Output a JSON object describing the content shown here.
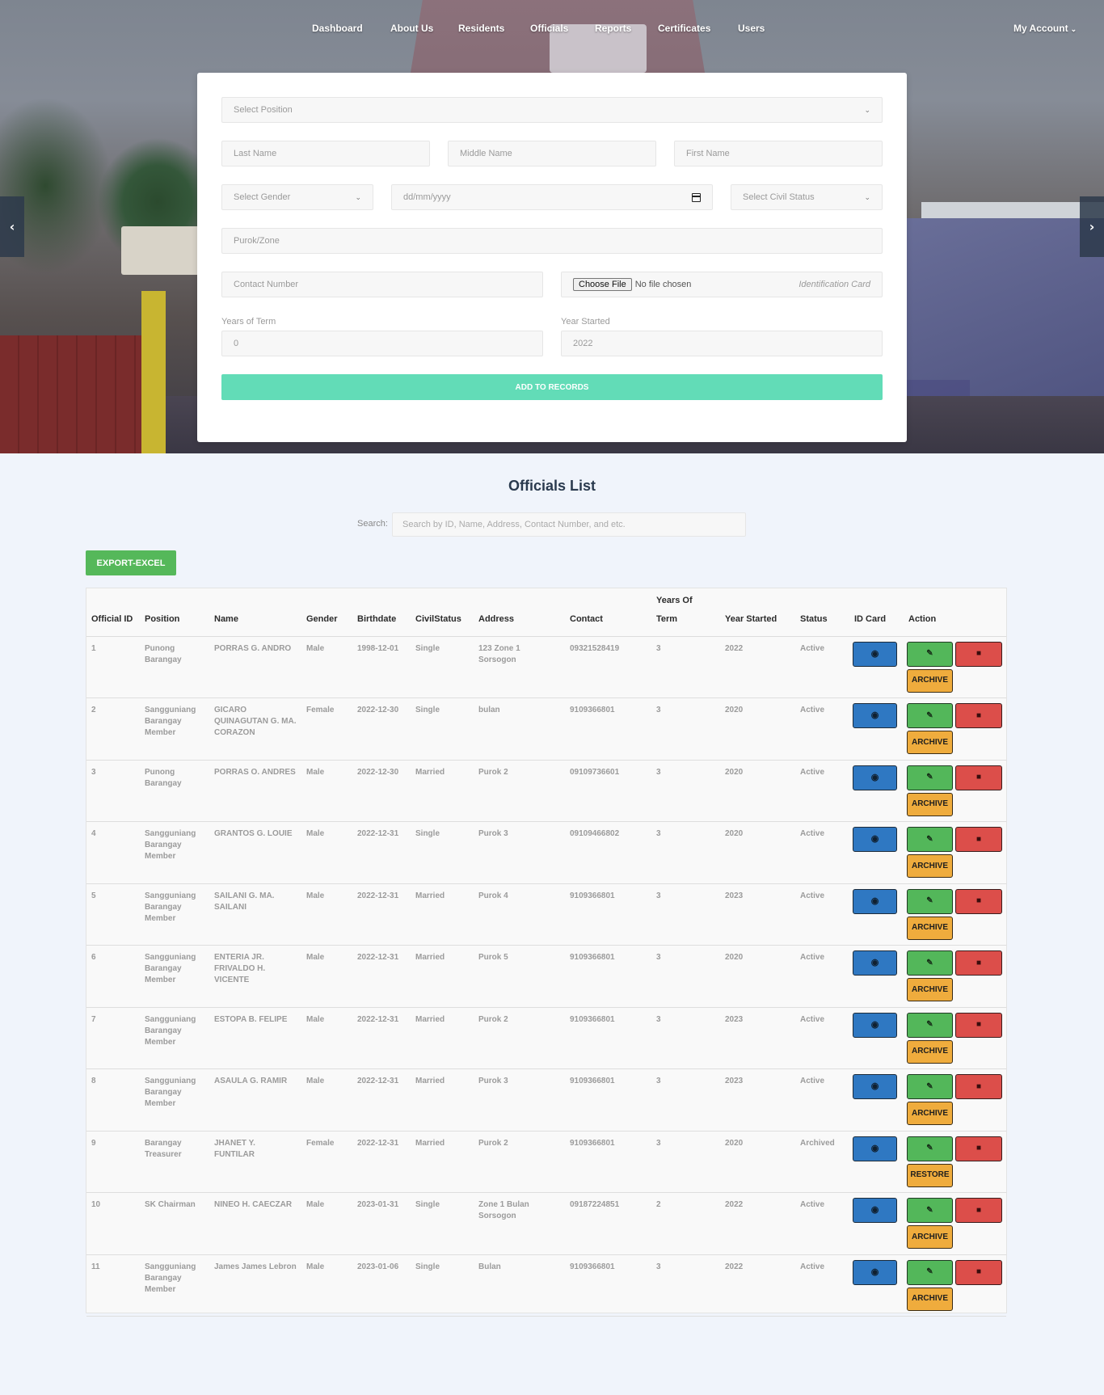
{
  "nav": {
    "items": [
      "Dashboard",
      "About Us",
      "Residents",
      "Officials",
      "Reports",
      "Certificates",
      "Users"
    ],
    "account_label": "My Account"
  },
  "form": {
    "position_placeholder": "Select Position",
    "last_name_placeholder": "Last Name",
    "middle_name_placeholder": "Middle Name",
    "first_name_placeholder": "First Name",
    "gender_placeholder": "Select Gender",
    "birthdate_placeholder": "dd/mm/yyyy",
    "civil_status_placeholder": "Select Civil Status",
    "purok_placeholder": "Purok/Zone",
    "contact_placeholder": "Contact Number",
    "file_button": "Choose File",
    "file_status": "No file chosen",
    "file_hint": "Identification Card",
    "years_of_term_label": "Years of Term",
    "years_of_term_value": "0",
    "year_started_label": "Year Started",
    "year_started_value": "2022",
    "submit_label": "ADD TO RECORDS"
  },
  "list": {
    "title": "Officials List",
    "search_label": "Search:",
    "search_placeholder": "Search by ID, Name, Address, Contact Number, and etc.",
    "export_label": "EXPORT-EXCEL",
    "columns": [
      "Official ID",
      "Position",
      "Name",
      "Gender",
      "Birthdate",
      "CivilStatus",
      "Address",
      "Contact",
      "Years Of Term",
      "Year Started",
      "Status",
      "ID Card",
      "Action"
    ],
    "rows": [
      {
        "id": "1",
        "position": "Punong Barangay",
        "name": "PORRAS G. ANDRO",
        "gender": "Male",
        "birthdate": "1998-12-01",
        "civil": "Single",
        "address": "123 Zone 1 Sorsogon",
        "contact": "09321528419",
        "term": "3",
        "started": "2022",
        "status": "Active",
        "toggle": "ARCHIVE"
      },
      {
        "id": "2",
        "position": "Sangguniang Barangay Member",
        "name": "GICARO QUINAGUTAN G. MA. CORAZON",
        "gender": "Female",
        "birthdate": "2022-12-30",
        "civil": "Single",
        "address": "bulan",
        "contact": "9109366801",
        "term": "3",
        "started": "2020",
        "status": "Active",
        "toggle": "ARCHIVE"
      },
      {
        "id": "3",
        "position": "Punong Barangay",
        "name": "PORRAS O. ANDRES",
        "gender": "Male",
        "birthdate": "2022-12-30",
        "civil": "Married",
        "address": "Purok 2",
        "contact": "09109736601",
        "term": "3",
        "started": "2020",
        "status": "Active",
        "toggle": "ARCHIVE"
      },
      {
        "id": "4",
        "position": "Sangguniang Barangay Member",
        "name": "GRANTOS G. LOUIE",
        "gender": "Male",
        "birthdate": "2022-12-31",
        "civil": "Single",
        "address": "Purok 3",
        "contact": "09109466802",
        "term": "3",
        "started": "2020",
        "status": "Active",
        "toggle": "ARCHIVE"
      },
      {
        "id": "5",
        "position": "Sangguniang Barangay Member",
        "name": "SAILANI G. MA. SAILANI",
        "gender": "Male",
        "birthdate": "2022-12-31",
        "civil": "Married",
        "address": "Purok 4",
        "contact": "9109366801",
        "term": "3",
        "started": "2023",
        "status": "Active",
        "toggle": "ARCHIVE"
      },
      {
        "id": "6",
        "position": "Sangguniang Barangay Member",
        "name": "ENTERIA JR. FRIVALDO H. VICENTE",
        "gender": "Male",
        "birthdate": "2022-12-31",
        "civil": "Married",
        "address": "Purok 5",
        "contact": "9109366801",
        "term": "3",
        "started": "2020",
        "status": "Active",
        "toggle": "ARCHIVE"
      },
      {
        "id": "7",
        "position": "Sangguniang Barangay Member",
        "name": "ESTOPA B. FELIPE",
        "gender": "Male",
        "birthdate": "2022-12-31",
        "civil": "Married",
        "address": "Purok 2",
        "contact": "9109366801",
        "term": "3",
        "started": "2023",
        "status": "Active",
        "toggle": "ARCHIVE"
      },
      {
        "id": "8",
        "position": "Sangguniang Barangay Member",
        "name": "ASAULA G. RAMIR",
        "gender": "Male",
        "birthdate": "2022-12-31",
        "civil": "Married",
        "address": "Purok 3",
        "contact": "9109366801",
        "term": "3",
        "started": "2023",
        "status": "Active",
        "toggle": "ARCHIVE"
      },
      {
        "id": "9",
        "position": "Barangay Treasurer",
        "name": "JHANET Y. FUNTILAR",
        "gender": "Female",
        "birthdate": "2022-12-31",
        "civil": "Married",
        "address": "Purok 2",
        "contact": "9109366801",
        "term": "3",
        "started": "2020",
        "status": "Archived",
        "toggle": "RESTORE"
      },
      {
        "id": "10",
        "position": "SK Chairman",
        "name": "NINEO H. CAECZAR",
        "gender": "Male",
        "birthdate": "2023-01-31",
        "civil": "Single",
        "address": "Zone 1 Bulan Sorsogon",
        "contact": "09187224851",
        "term": "2",
        "started": "2022",
        "status": "Active",
        "toggle": "ARCHIVE"
      },
      {
        "id": "11",
        "position": "Sangguniang Barangay Member",
        "name": "James James Lebron",
        "gender": "Male",
        "birthdate": "2023-01-06",
        "civil": "Single",
        "address": "Bulan",
        "contact": "9109366801",
        "term": "3",
        "started": "2022",
        "status": "Active",
        "toggle": "ARCHIVE"
      }
    ]
  },
  "colors": {
    "primary_button": "#62dcb7",
    "export_button": "#55b85a",
    "view_button": "#2f78c2",
    "edit_button": "#53b75a",
    "delete_button": "#dc4e4a",
    "archive_button": "#efac3d"
  },
  "icons": {
    "view": "eye-icon",
    "edit": "edit-icon",
    "delete": "trash-icon",
    "slider_prev": "chevron-left-icon",
    "slider_next": "chevron-right-icon",
    "account_caret": "chevron-down-icon"
  }
}
